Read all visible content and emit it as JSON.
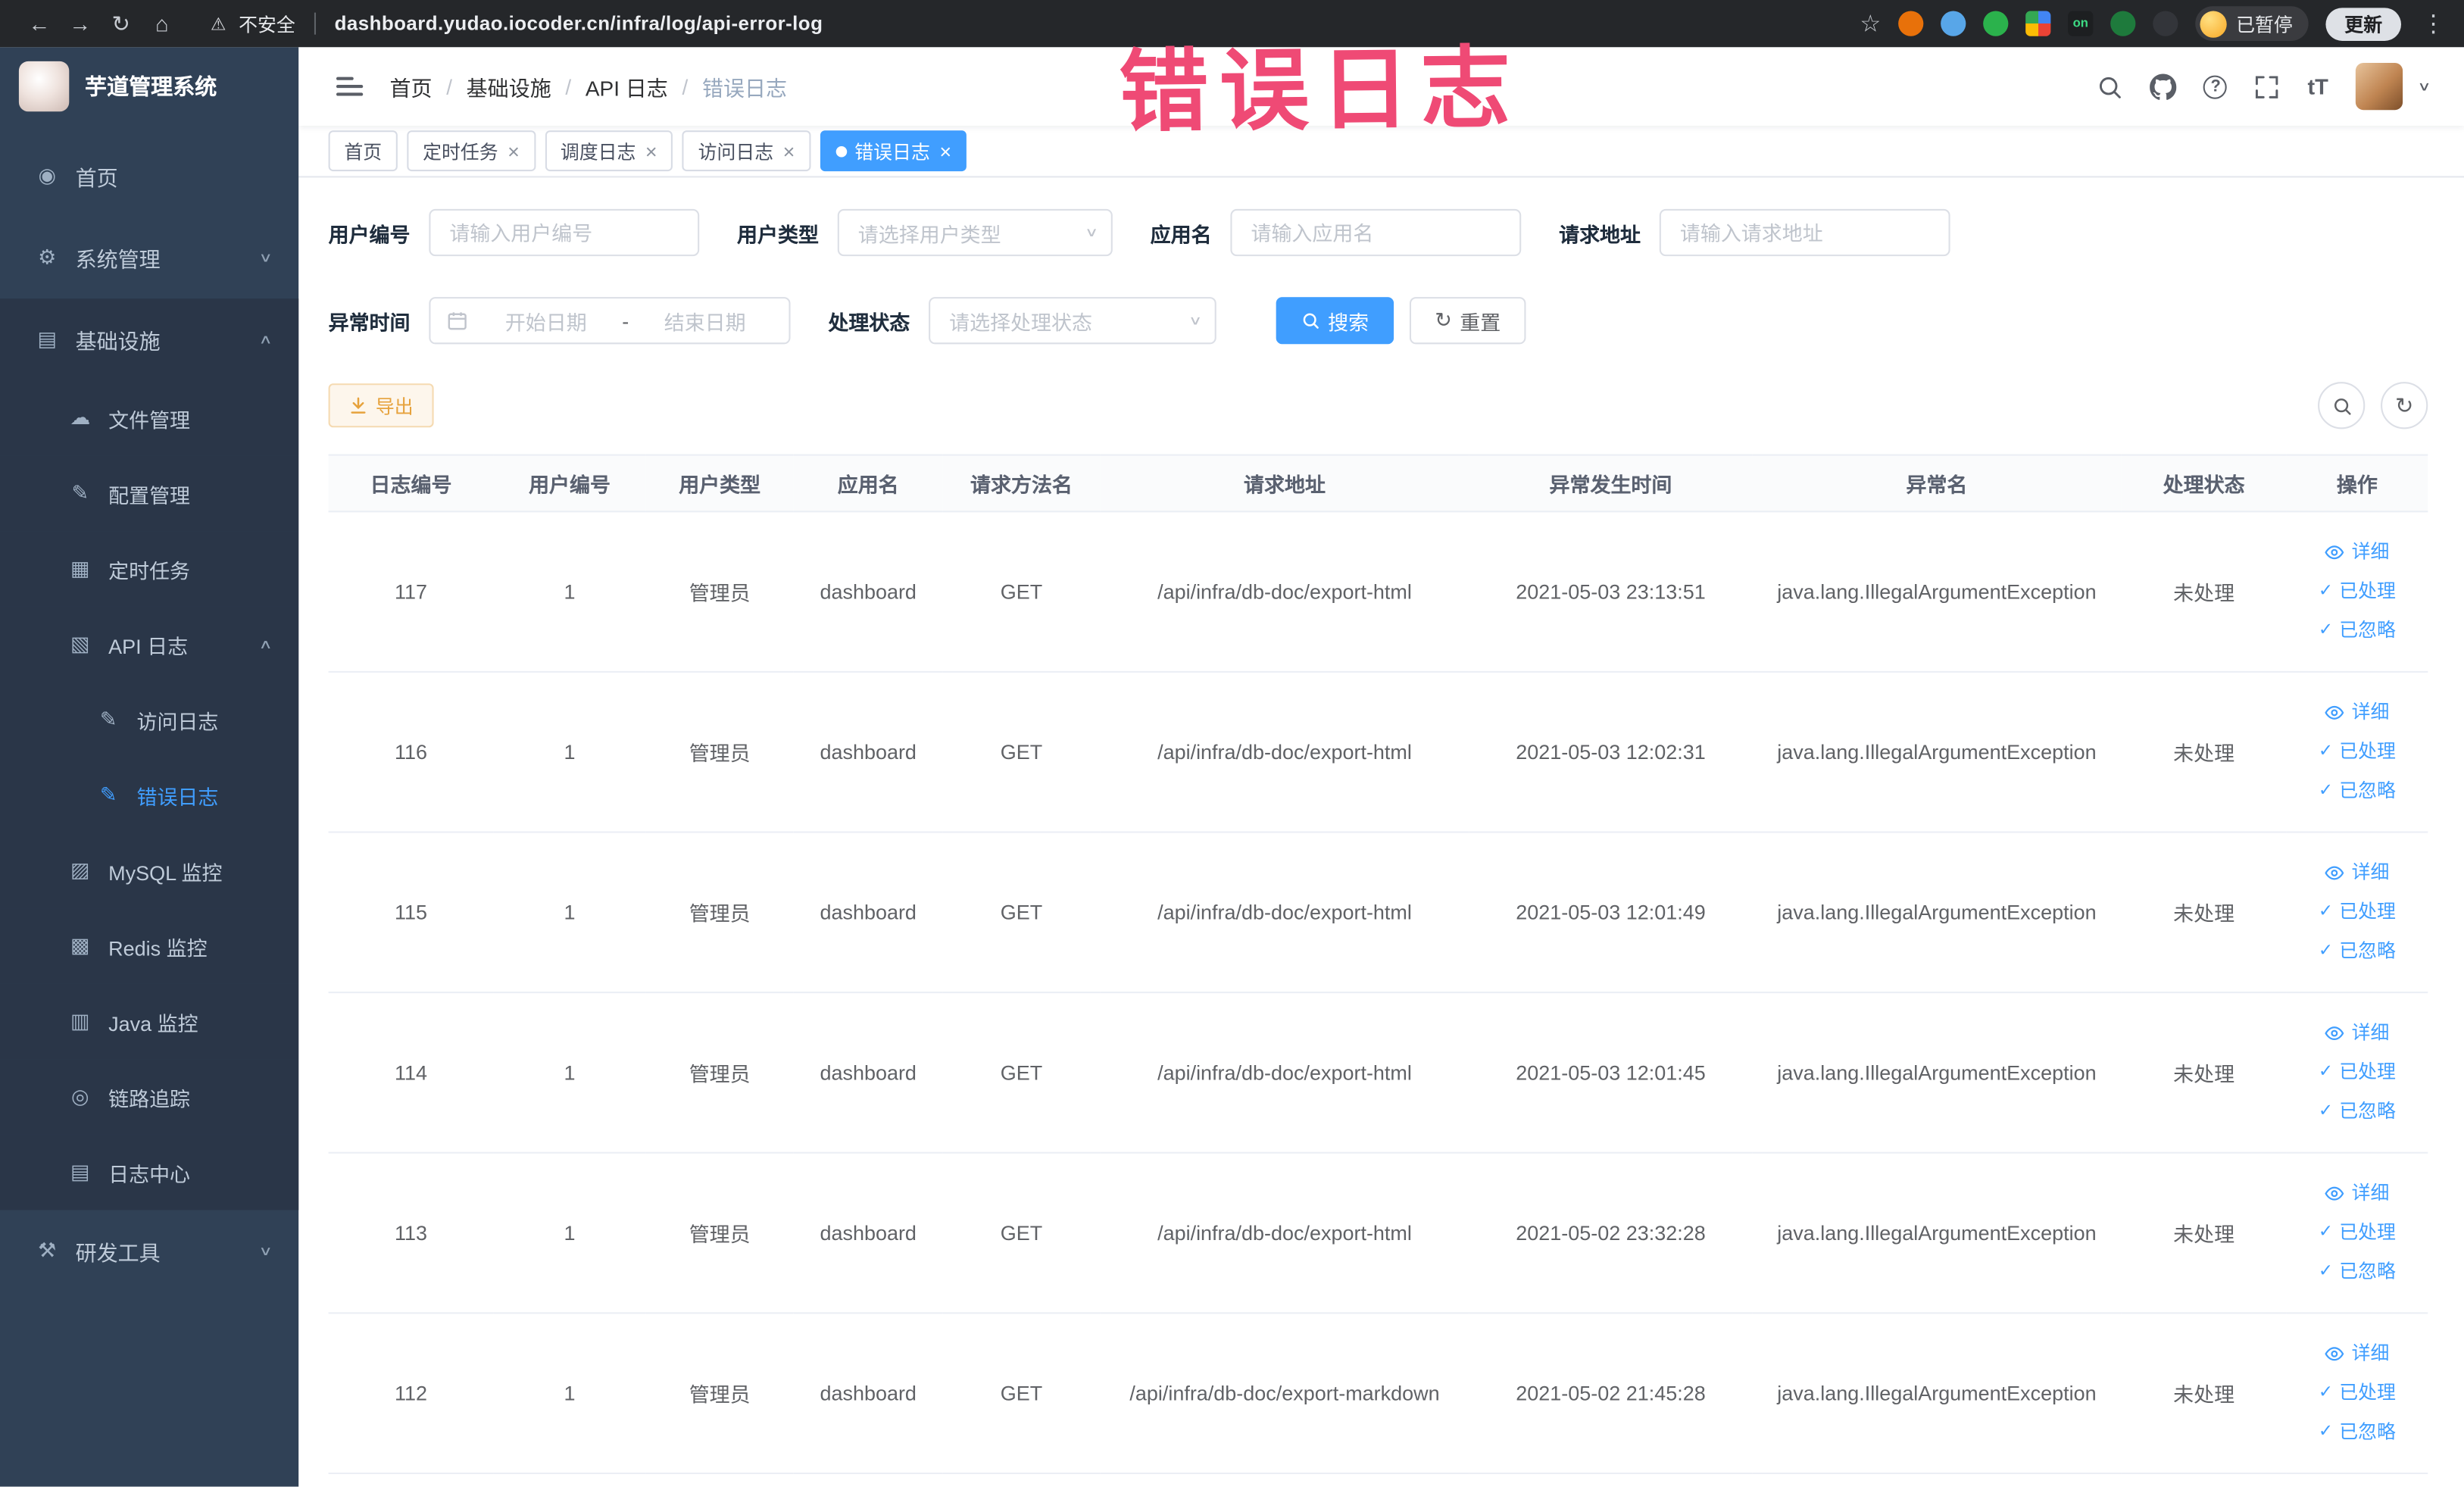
{
  "annotation": {
    "text": "错误日志"
  },
  "icons": {
    "chevron_down": "∨",
    "chevron_up": "∧",
    "check": "✓",
    "close": "×",
    "refresh": "↻",
    "kebab": "⋮",
    "question_mark": "?",
    "caret_down": "∨",
    "separator_slash": "/",
    "star": "☆",
    "dash": "-"
  },
  "colors": {
    "primary": "#409eff",
    "link": "#409eff",
    "warning_text": "#e6a23c",
    "warning_bg": "#fdf6ec",
    "warning_border": "#f5dab1",
    "sidebar_bg": "#304156",
    "sidebar_submenu_bg": "#2a3648",
    "sidebar_text": "#bfcbd9",
    "annotation": "#ef4a75",
    "active_tab_bg": "#409eff"
  },
  "browser": {
    "nav_icons": [
      {
        "name": "back-icon",
        "glyph": "←"
      },
      {
        "name": "forward-icon",
        "glyph": "→"
      },
      {
        "name": "reload-icon",
        "glyph": "↻"
      },
      {
        "name": "home-icon",
        "glyph": "⌂"
      }
    ],
    "security_warning": {
      "icon": "⚠",
      "text": "不安全"
    },
    "url": "dashboard.yudao.iocoder.cn/infra/log/api-error-log",
    "extensions": [
      {
        "name": "extension-icon-1",
        "type": "circle",
        "color": "#e8710a"
      },
      {
        "name": "extension-icon-2",
        "type": "circle",
        "color": "#58a6e8"
      },
      {
        "name": "extension-icon-3",
        "type": "circle",
        "color": "#2bb24c"
      },
      {
        "name": "extension-icon-4",
        "type": "grid",
        "colors": [
          "#4285f4",
          "#ea4335",
          "#fbbc05",
          "#34a853"
        ]
      },
      {
        "name": "extension-icon-5",
        "type": "square",
        "color": "#1d1f21",
        "badge": "on",
        "badge_color": "#3ddc84"
      },
      {
        "name": "extension-icon-6",
        "type": "circle",
        "color": "#1e7a3c"
      },
      {
        "name": "extension-icon-7",
        "type": "circle",
        "color": "#33353a"
      }
    ],
    "paused_badge": "已暂停",
    "update_button": "更新"
  },
  "sidebar": {
    "app_title": "芋道管理系统",
    "items": [
      {
        "id": "home",
        "label": "首页",
        "icon": "dashboard-icon",
        "glyph": "◉",
        "depth": 1
      },
      {
        "id": "system",
        "label": "系统管理",
        "icon": "gear-icon",
        "glyph": "⚙",
        "depth": 1,
        "chevron": "down"
      },
      {
        "id": "infra",
        "label": "基础设施",
        "icon": "infrastructure-icon",
        "glyph": "▤",
        "depth": 1,
        "chevron": "up",
        "dark": true
      },
      {
        "id": "file",
        "label": "文件管理",
        "icon": "cloud-icon",
        "glyph": "☁",
        "depth": 2,
        "dark": true
      },
      {
        "id": "config",
        "label": "配置管理",
        "icon": "edit-icon",
        "glyph": "✎",
        "depth": 2,
        "dark": true
      },
      {
        "id": "job",
        "label": "定时任务",
        "icon": "schedule-icon",
        "glyph": "▦",
        "depth": 2,
        "dark": true
      },
      {
        "id": "api-log",
        "label": "API 日志",
        "icon": "api-log-icon",
        "glyph": "▧",
        "depth": 2,
        "chevron": "up",
        "dark": true
      },
      {
        "id": "access-log",
        "label": "访问日志",
        "icon": "access-log-icon",
        "glyph": "✎",
        "depth": 3,
        "dark": true
      },
      {
        "id": "error-log",
        "label": "错误日志",
        "icon": "error-log-icon",
        "glyph": "✎",
        "depth": 3,
        "dark": true,
        "active": true
      },
      {
        "id": "mysql",
        "label": "MySQL 监控",
        "icon": "mysql-monitor-icon",
        "glyph": "▨",
        "depth": 2,
        "dark": true
      },
      {
        "id": "redis",
        "label": "Redis 监控",
        "icon": "redis-monitor-icon",
        "glyph": "▩",
        "depth": 2,
        "dark": true
      },
      {
        "id": "java",
        "label": "Java 监控",
        "icon": "java-monitor-icon",
        "glyph": "▥",
        "depth": 2,
        "dark": true
      },
      {
        "id": "tracing",
        "label": "链路追踪",
        "icon": "trace-icon",
        "glyph": "◎",
        "depth": 2,
        "dark": true
      },
      {
        "id": "log-center",
        "label": "日志中心",
        "icon": "log-center-icon",
        "glyph": "▤",
        "depth": 2,
        "dark": true
      },
      {
        "id": "devtools",
        "label": "研发工具",
        "icon": "toolbox-icon",
        "glyph": "⚒",
        "depth": 1,
        "chevron": "down"
      }
    ]
  },
  "header": {
    "breadcrumb": [
      "首页",
      "基础设施",
      "API 日志",
      "错误日志"
    ],
    "font_size_icon_text": "tT"
  },
  "tabs": [
    {
      "id": "home",
      "label": "首页",
      "closable": false,
      "active": false
    },
    {
      "id": "job",
      "label": "定时任务",
      "closable": true,
      "active": false
    },
    {
      "id": "job-log",
      "label": "调度日志",
      "closable": true,
      "active": false
    },
    {
      "id": "access-log",
      "label": "访问日志",
      "closable": true,
      "active": false
    },
    {
      "id": "error-log",
      "label": "错误日志",
      "closable": true,
      "active": true
    }
  ],
  "filters": {
    "user_id": {
      "label": "用户编号",
      "placeholder": "请输入用户编号"
    },
    "user_type": {
      "label": "用户类型",
      "placeholder": "请选择用户类型"
    },
    "app_name": {
      "label": "应用名",
      "placeholder": "请输入应用名"
    },
    "request_url": {
      "label": "请求地址",
      "placeholder": "请输入请求地址"
    },
    "exception_time": {
      "label": "异常时间",
      "start_placeholder": "开始日期",
      "separator": "-",
      "end_placeholder": "结束日期"
    },
    "process_status": {
      "label": "处理状态",
      "placeholder": "请选择处理状态"
    },
    "search_button": "搜索",
    "reset_button": "重置"
  },
  "toolbar": {
    "export_label": "导出"
  },
  "table": {
    "columns": [
      "日志编号",
      "用户编号",
      "用户类型",
      "应用名",
      "请求方法名",
      "请求地址",
      "异常发生时间",
      "异常名",
      "处理状态",
      "操作"
    ],
    "actions": [
      {
        "id": "detail",
        "label": "详细",
        "icon": "eye-icon"
      },
      {
        "id": "processed",
        "label": "已处理",
        "icon": "check-icon"
      },
      {
        "id": "ignored",
        "label": "已忽略",
        "icon": "check-icon"
      }
    ],
    "rows": [
      {
        "log_id": "117",
        "user_id": "1",
        "user_type": "管理员",
        "app_name": "dashboard",
        "method": "GET",
        "url": "/api/infra/db-doc/export-html",
        "time": "2021-05-03 23:13:51",
        "exception": "java.lang.IllegalArgumentException",
        "status": "未处理"
      },
      {
        "log_id": "116",
        "user_id": "1",
        "user_type": "管理员",
        "app_name": "dashboard",
        "method": "GET",
        "url": "/api/infra/db-doc/export-html",
        "time": "2021-05-03 12:02:31",
        "exception": "java.lang.IllegalArgumentException",
        "status": "未处理"
      },
      {
        "log_id": "115",
        "user_id": "1",
        "user_type": "管理员",
        "app_name": "dashboard",
        "method": "GET",
        "url": "/api/infra/db-doc/export-html",
        "time": "2021-05-03 12:01:49",
        "exception": "java.lang.IllegalArgumentException",
        "status": "未处理"
      },
      {
        "log_id": "114",
        "user_id": "1",
        "user_type": "管理员",
        "app_name": "dashboard",
        "method": "GET",
        "url": "/api/infra/db-doc/export-html",
        "time": "2021-05-03 12:01:45",
        "exception": "java.lang.IllegalArgumentException",
        "status": "未处理"
      },
      {
        "log_id": "113",
        "user_id": "1",
        "user_type": "管理员",
        "app_name": "dashboard",
        "method": "GET",
        "url": "/api/infra/db-doc/export-html",
        "time": "2021-05-02 23:32:28",
        "exception": "java.lang.IllegalArgumentException",
        "status": "未处理"
      },
      {
        "log_id": "112",
        "user_id": "1",
        "user_type": "管理员",
        "app_name": "dashboard",
        "method": "GET",
        "url": "/api/infra/db-doc/export-markdown",
        "time": "2021-05-02 21:45:28",
        "exception": "java.lang.IllegalArgumentException",
        "status": "未处理"
      }
    ]
  }
}
